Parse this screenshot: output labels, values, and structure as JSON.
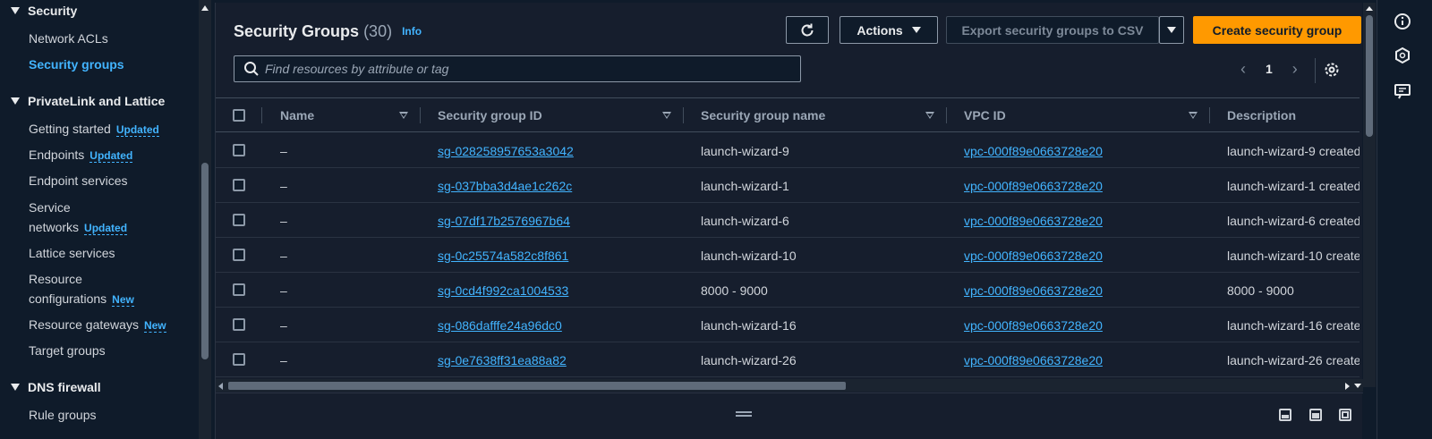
{
  "sidebar": {
    "sections": [
      {
        "title": "Security",
        "items": [
          {
            "label": "Network ACLs",
            "badge": ""
          },
          {
            "label": "Security groups",
            "badge": ""
          }
        ]
      },
      {
        "title": "PrivateLink and Lattice",
        "items": [
          {
            "label": "Getting started",
            "badge": "Updated"
          },
          {
            "label": "Endpoints",
            "badge": "Updated"
          },
          {
            "label": "Endpoint services",
            "badge": ""
          },
          {
            "label": "Service",
            "label2": "networks",
            "badge": "Updated"
          },
          {
            "label": "Lattice services",
            "badge": ""
          },
          {
            "label": "Resource",
            "label2": "configurations",
            "badge": "New"
          },
          {
            "label": "Resource gateways",
            "badge": "New"
          },
          {
            "label": "Target groups",
            "badge": ""
          }
        ]
      },
      {
        "title": "DNS firewall",
        "items": [
          {
            "label": "Rule groups",
            "badge": ""
          }
        ]
      }
    ],
    "active_item": "Security groups"
  },
  "header": {
    "title": "Security Groups",
    "count": "(30)",
    "info": "Info",
    "actions_label": "Actions",
    "export_label": "Export security groups to CSV",
    "create_label": "Create security group"
  },
  "search": {
    "placeholder": "Find resources by attribute or tag",
    "value": ""
  },
  "pagination": {
    "current_page": "1"
  },
  "table": {
    "columns": [
      "Name",
      "Security group ID",
      "Security group name",
      "VPC ID",
      "Description"
    ],
    "rows": [
      {
        "name": "–",
        "id": "sg-028258957653a3042",
        "group_name": "launch-wizard-9",
        "vpc": "vpc-000f89e0663728e20",
        "desc": "launch-wizard-9 created"
      },
      {
        "name": "–",
        "id": "sg-037bba3d4ae1c262c",
        "group_name": "launch-wizard-1",
        "vpc": "vpc-000f89e0663728e20",
        "desc": "launch-wizard-1 created"
      },
      {
        "name": "–",
        "id": "sg-07df17b2576967b64",
        "group_name": "launch-wizard-6",
        "vpc": "vpc-000f89e0663728e20",
        "desc": "launch-wizard-6 created"
      },
      {
        "name": "–",
        "id": "sg-0c25574a582c8f861",
        "group_name": "launch-wizard-10",
        "vpc": "vpc-000f89e0663728e20",
        "desc": "launch-wizard-10 create"
      },
      {
        "name": "–",
        "id": "sg-0cd4f992ca1004533",
        "group_name": "8000 - 9000",
        "vpc": "vpc-000f89e0663728e20",
        "desc": "8000 - 9000"
      },
      {
        "name": "–",
        "id": "sg-086dafffe24a96dc0",
        "group_name": "launch-wizard-16",
        "vpc": "vpc-000f89e0663728e20",
        "desc": "launch-wizard-16 create"
      },
      {
        "name": "–",
        "id": "sg-0e7638ff31ea88a82",
        "group_name": "launch-wizard-26",
        "vpc": "vpc-000f89e0663728e20",
        "desc": "launch-wizard-26 create"
      }
    ]
  },
  "icons": {
    "refresh": "refresh-icon",
    "search": "search-icon",
    "settings": "gear-icon",
    "rail": [
      "info-icon",
      "cloudshell-icon",
      "feedback-icon"
    ]
  },
  "colors": {
    "accent": "#ff9900",
    "link": "#42b4ff",
    "background": "#0f1b2a",
    "panel": "#161e2d"
  }
}
